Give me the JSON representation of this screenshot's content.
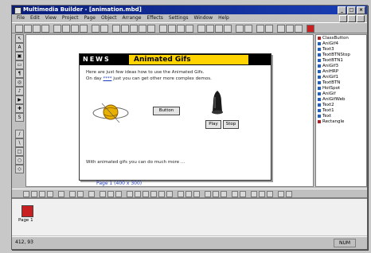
{
  "window": {
    "title": "Multimedia Builder - [animation.mbd]"
  },
  "menu": [
    "File",
    "Edit",
    "View",
    "Project",
    "Page",
    "Object",
    "Arrange",
    "Effects",
    "Settings",
    "Window",
    "Help"
  ],
  "page": {
    "news": "NEWS",
    "banner": "Animated Gifs",
    "line1": "Here are just few ideas how to use the Animated Gifs.",
    "line2_pre": "On day",
    "line2_link": "****",
    "line2_post": "just you can get other more complex demos.",
    "button_label": "Button",
    "play_label": "Play",
    "stop_label": "Stop",
    "footer": "With animated gifs you can do much more ..."
  },
  "canvas_label": "Page 1 (400 x 300)",
  "objects": [
    {
      "name": "ClassButton",
      "color": "#b02020"
    },
    {
      "name": "AniGif4",
      "color": "#2060c0"
    },
    {
      "name": "Text3",
      "color": "#2060c0"
    },
    {
      "name": "TextBTNStop",
      "color": "#2060c0"
    },
    {
      "name": "TextBTN1",
      "color": "#2060c0"
    },
    {
      "name": "AniGif3",
      "color": "#2060c0"
    },
    {
      "name": "AniHRP",
      "color": "#2060c0"
    },
    {
      "name": "AniGif1",
      "color": "#2060c0"
    },
    {
      "name": "TextBTN",
      "color": "#2060c0"
    },
    {
      "name": "HotSpot",
      "color": "#2060c0"
    },
    {
      "name": "AniGif",
      "color": "#2060c0"
    },
    {
      "name": "AniGifWeb",
      "color": "#2060c0"
    },
    {
      "name": "Text2",
      "color": "#2060c0"
    },
    {
      "name": "Text1",
      "color": "#2060c0"
    },
    {
      "name": "Text",
      "color": "#2060c0"
    },
    {
      "name": "Rectangle",
      "color": "#b02020"
    }
  ],
  "strip": {
    "thumb_label": "Page 1"
  },
  "status": {
    "left": "412, 93",
    "right": "NUM"
  }
}
